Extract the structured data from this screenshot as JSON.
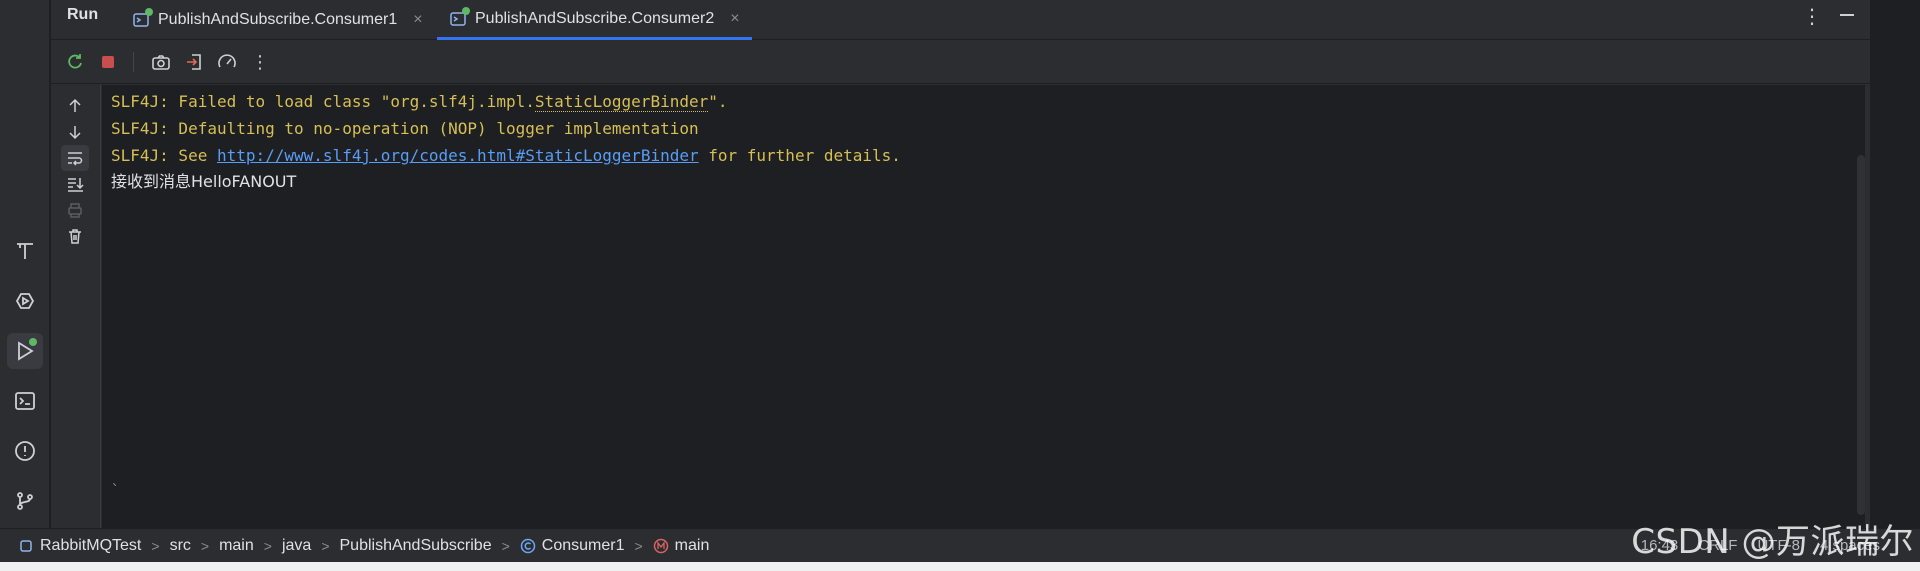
{
  "tool_window": {
    "title": "Run",
    "tabs": [
      {
        "label": "PublishAndSubscribe.Consumer1",
        "active": false
      },
      {
        "label": "PublishAndSubscribe.Consumer2",
        "active": true
      }
    ],
    "close_glyph": "×",
    "menu_glyph": "⋮"
  },
  "toolbar": {
    "icons": [
      "rerun-icon",
      "stop-icon",
      "camera-icon",
      "exit-icon",
      "profiler-icon",
      "more-icon"
    ],
    "more_glyph": "⋮"
  },
  "stripe": {
    "icons": [
      "build-icon",
      "services-icon",
      "run-icon",
      "terminal-icon",
      "problems-icon",
      "git-icon"
    ],
    "active": "run-icon"
  },
  "side_toolbar": {
    "icons": [
      "scroll-up-icon",
      "scroll-down-icon",
      "soft-wrap-icon",
      "scroll-to-end-icon",
      "print-icon",
      "clear-icon"
    ]
  },
  "console": {
    "line1_prefix": "SLF4J: Failed to load class \"org.slf4j.impl.",
    "line1_class": "StaticLoggerBinder",
    "line1_suffix": "\".",
    "line2": "SLF4J: Defaulting to no-operation (NOP) logger implementation",
    "line3_prefix": "SLF4J: See ",
    "line3_link": "http://www.slf4j.org/codes.html#StaticLoggerBinder",
    "line3_suffix": " for further details.",
    "line4": "接收到消息HelloFANOUT",
    "cursor": "`"
  },
  "breadcrumbs": [
    "RabbitMQTest",
    "src",
    "main",
    "java",
    "PublishAndSubscribe",
    "Consumer1",
    "main"
  ],
  "status_right": {
    "position": "16:43",
    "line_sep": "CRLF",
    "encoding": "UTF-8",
    "indent": "4 spaces"
  },
  "watermark": "CSDN @万派瑞尔",
  "colors": {
    "accent": "#3574f0",
    "warning_text": "#d6bf55",
    "link": "#589df6",
    "running_dot": "#5fb865"
  }
}
